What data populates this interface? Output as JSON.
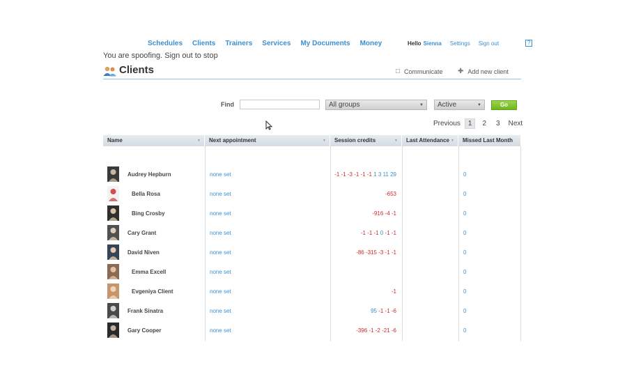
{
  "nav": {
    "items": [
      "Schedules",
      "Clients",
      "Trainers",
      "Services",
      "My Documents",
      "Money"
    ]
  },
  "user": {
    "hello": "Hello",
    "name": "Sienna",
    "settings": "Settings",
    "signout": "Sign out",
    "help": "?"
  },
  "spoof_message": "You are spoofing. Sign out to stop",
  "header": {
    "title": "Clients",
    "communicate": "Communicate",
    "add_client": "Add new client"
  },
  "filters": {
    "find_label": "Find",
    "find_value": "",
    "group_select": "All groups",
    "status_select": "Active",
    "go_label": "Go"
  },
  "pager": {
    "previous": "Previous",
    "pages": [
      "1",
      "2",
      "3"
    ],
    "current": "1",
    "next": "Next"
  },
  "table": {
    "columns": [
      "Name",
      "Next appointment",
      "Session credits",
      "Last Attendance",
      "Missed Last Month"
    ],
    "rows": [
      {
        "name": "Audrey Hepburn",
        "appointment": "none set",
        "credits": [
          [
            "-1 -1 -3 -1 -1 -1",
            "neg"
          ],
          [
            " 1 3 11 29",
            "pos"
          ]
        ],
        "last_attendance": "",
        "missed": "0"
      },
      {
        "name": "Bella Rosa",
        "appointment": "none set",
        "credits": [
          [
            "-653",
            "neg"
          ]
        ],
        "last_attendance": "",
        "missed": "0"
      },
      {
        "name": "Bing Crosby",
        "appointment": "none set",
        "credits": [
          [
            "-916 -4 -1",
            "neg"
          ]
        ],
        "last_attendance": "",
        "missed": "0"
      },
      {
        "name": "Cary Grant",
        "appointment": "none set",
        "credits": [
          [
            "-1 -1 -1",
            "neg"
          ],
          [
            " 0 ",
            "pos"
          ],
          [
            "-1 -1",
            "neg"
          ]
        ],
        "last_attendance": "",
        "missed": "0"
      },
      {
        "name": "David Niven",
        "appointment": "none set",
        "credits": [
          [
            "-86 -315 -3 -1 -1",
            "neg"
          ]
        ],
        "last_attendance": "",
        "missed": "0"
      },
      {
        "name": "Emma Excell",
        "appointment": "none set",
        "credits": [],
        "last_attendance": "",
        "missed": "0"
      },
      {
        "name": "Evgeniya Client",
        "appointment": "none set",
        "credits": [
          [
            "-1",
            "neg"
          ]
        ],
        "last_attendance": "",
        "missed": "0"
      },
      {
        "name": "Frank Sinatra",
        "appointment": "none set",
        "credits": [
          [
            "95",
            "pos"
          ],
          [
            " -1 -1 -6",
            "neg"
          ]
        ],
        "last_attendance": "",
        "missed": "0"
      },
      {
        "name": "Gary Cooper",
        "appointment": "none set",
        "credits": [
          [
            "-396 -1 -2 -21 -6",
            "neg"
          ]
        ],
        "last_attendance": "",
        "missed": "0"
      }
    ]
  },
  "colors": {
    "link": "#3a8fd0",
    "negative": "#d02828",
    "go_button": "#7cc02a"
  }
}
